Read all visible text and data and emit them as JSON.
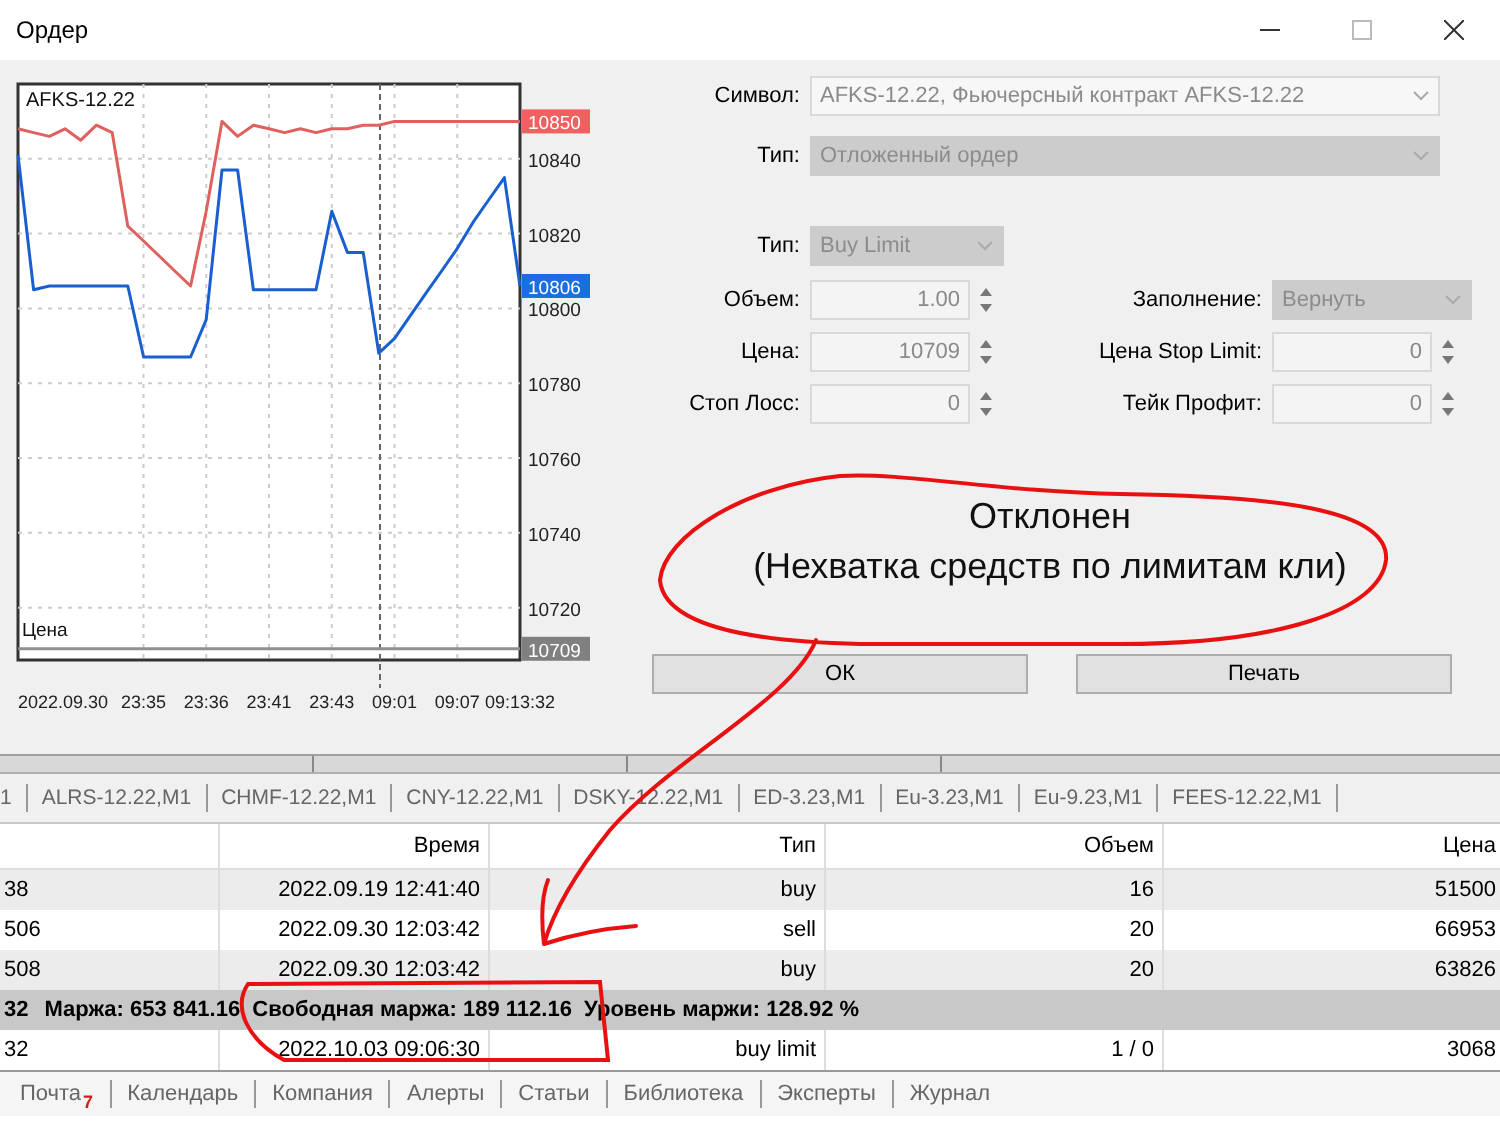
{
  "window": {
    "title": "Ордер"
  },
  "chart": {
    "symbol": "AFKS-12.22",
    "price_label": "Цена",
    "start_date": "2022.09.30",
    "price_tags": [
      {
        "value": "10850",
        "color": "#f06060"
      },
      {
        "value": "10806",
        "color": "#1a6fe0"
      },
      {
        "value": "10709",
        "color": "#808080"
      }
    ],
    "chart_data": {
      "type": "line",
      "categories": [
        null,
        null,
        null,
        null,
        null,
        null,
        null,
        null,
        "23:35",
        null,
        null,
        null,
        "23:36",
        null,
        null,
        null,
        "23:41",
        null,
        null,
        null,
        "23:43",
        null,
        null,
        null,
        "09:01",
        null,
        null,
        null,
        "09:07",
        null,
        null,
        null,
        "09:13:32"
      ],
      "series": [
        {
          "color": "#e06060",
          "values": [
            10848,
            10847,
            10846,
            10848,
            10845,
            10849,
            10847,
            10822,
            10818,
            10814,
            10810,
            10806,
            10826,
            10850,
            10846,
            10849,
            10848,
            10847,
            10848,
            10847,
            10848,
            10848,
            10849,
            10849,
            10850,
            10850,
            10850,
            10850,
            10850,
            10850,
            10850,
            10850,
            10850
          ]
        },
        {
          "color": "#1a5fd0",
          "values": [
            10841,
            10805,
            10806,
            10806,
            10806,
            10806,
            10806,
            10806,
            10787,
            10787,
            10787,
            10787,
            10797,
            10837,
            10837,
            10805,
            10805,
            10805,
            10805,
            10805,
            10826,
            10815,
            10815,
            10788,
            10792,
            10798,
            10804,
            10810,
            10816,
            10823,
            10829,
            10835,
            10806
          ]
        },
        {
          "color": "#909090",
          "values": [
            10709,
            10709,
            10709,
            10709,
            10709,
            10709,
            10709,
            10709,
            10709,
            10709,
            10709,
            10709,
            10709,
            10709,
            10709,
            10709,
            10709,
            10709,
            10709,
            10709,
            10709,
            10709,
            10709,
            10709,
            10709,
            10709,
            10709,
            10709,
            10709,
            10709,
            10709,
            10709,
            10709
          ]
        }
      ],
      "ylim": [
        10706,
        10860
      ],
      "grid": true,
      "yticks": [
        10720,
        10740,
        10760,
        10780,
        10800,
        10820,
        10840
      ]
    }
  },
  "form": {
    "symbol": {
      "label": "Символ:",
      "value": "AFKS-12.22, Фьючерсный контракт AFKS-12.22",
      "disabled": false
    },
    "type": {
      "label": "Тип:",
      "value": "Отложенный ордер",
      "disabled": true
    },
    "order_type": {
      "label": "Тип:",
      "value": "Buy Limit",
      "disabled": true
    },
    "left_fields": [
      {
        "label": "Объем:",
        "value": "1.00"
      },
      {
        "label": "Цена:",
        "value": "10709"
      },
      {
        "label": "Стоп Лосс:",
        "value": "0"
      }
    ],
    "right_fields": [
      {
        "kind": "combo",
        "label": "Заполнение:",
        "value": "Вернуть",
        "disabled": true
      },
      {
        "kind": "spin",
        "label": "Цена Stop Limit:",
        "value": "0",
        "disabled": false
      },
      {
        "kind": "spin",
        "label": "Тейк Профит:",
        "value": "0",
        "disabled": false
      }
    ]
  },
  "message": [
    "Отклонен",
    "(Нехватка средств по лимитам кли)"
  ],
  "buttons": [
    "ОК",
    "Печать"
  ],
  "chart_tabs": [
    "1",
    "ALRS-12.22,M1",
    "CHMF-12.22,M1",
    "CNY-12.22,M1",
    "DSKY-12.22,M1",
    "ED-3.23,M1",
    "Eu-3.23,M1",
    "Eu-9.23,M1",
    "FEES-12.22,M1"
  ],
  "table": {
    "columns": [
      "",
      "Время",
      "Тип",
      "Объем",
      "Цена"
    ],
    "rows": [
      {
        "kind": "order",
        "cells": [
          "38",
          "2022.09.19 12:41:40",
          "buy",
          "16",
          "51500"
        ]
      },
      {
        "kind": "order",
        "cells": [
          "506",
          "2022.09.30 12:03:42",
          "sell",
          "20",
          "66953"
        ]
      },
      {
        "kind": "order",
        "cells": [
          "508",
          "2022.09.30 12:03:42",
          "buy",
          "20",
          "63826"
        ]
      },
      {
        "kind": "summary",
        "cells": [
          "32"
        ],
        "totals": "Маржа: 653 841.16  Свободная маржа: 189 112.16  Уровень маржи: 128.92 %"
      },
      {
        "kind": "order",
        "cells": [
          "32",
          "2022.10.03 09:06:30",
          "buy limit",
          "1 / 0",
          "3068"
        ]
      }
    ]
  },
  "bottom_tabs": [
    {
      "label": "Почта",
      "badge": "7"
    },
    {
      "label": "Календарь"
    },
    {
      "label": "Компания"
    },
    {
      "label": "Алерты"
    },
    {
      "label": "Статьи"
    },
    {
      "label": "Библиотека"
    },
    {
      "label": "Эксперты"
    },
    {
      "label": "Журнал"
    }
  ],
  "annotation": {
    "kind": "freehand"
  }
}
